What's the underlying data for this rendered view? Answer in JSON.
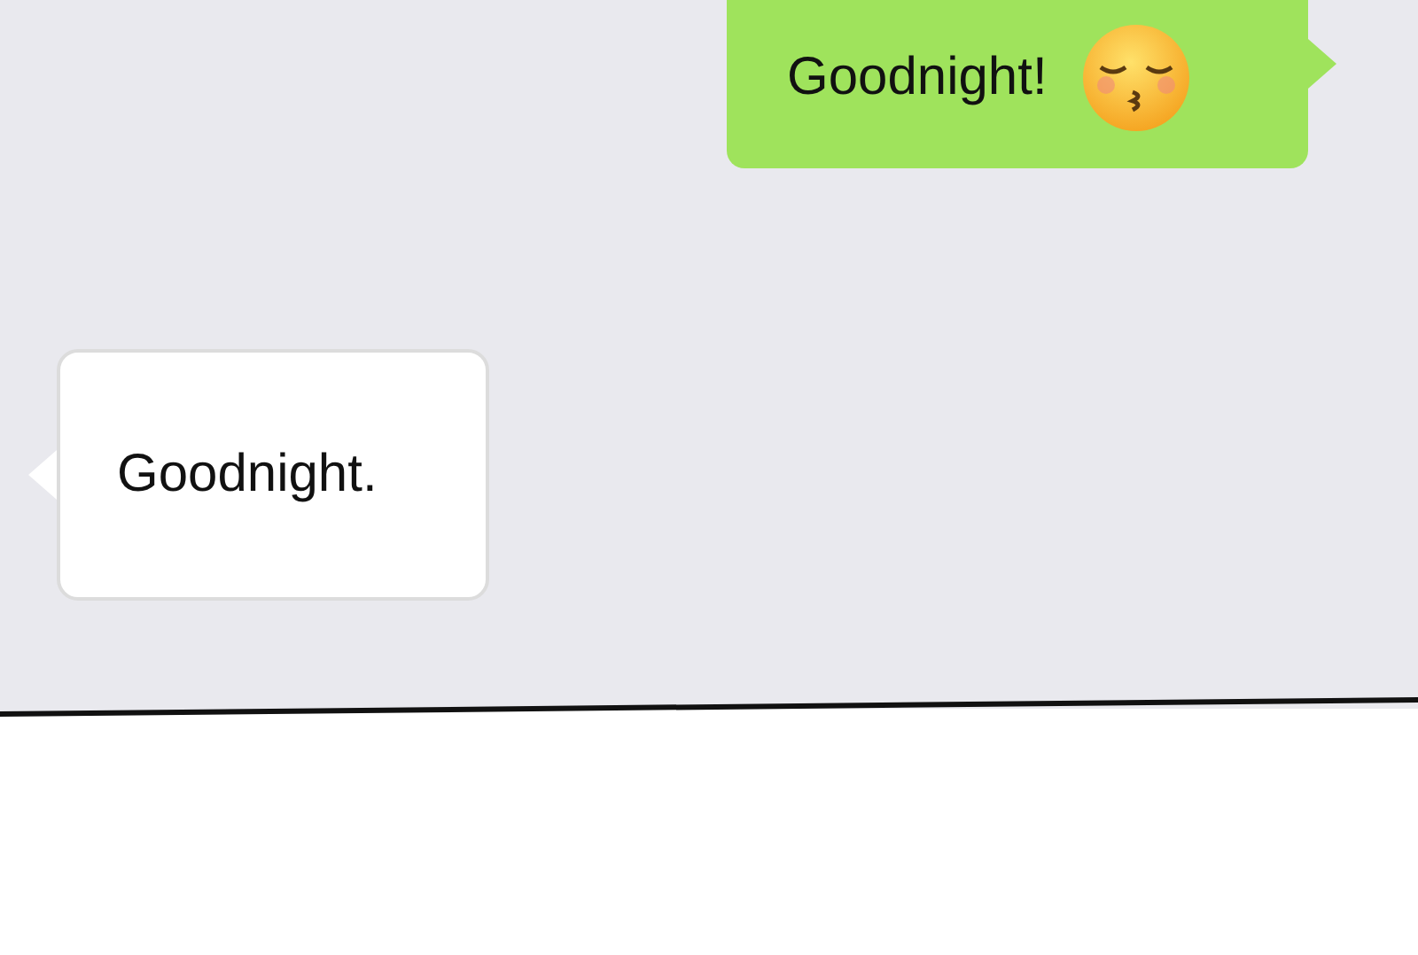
{
  "messages": [
    {
      "kind": "sent",
      "text": "Goodnight!"
    },
    {
      "kind": "received",
      "text": "Goodnight."
    }
  ]
}
